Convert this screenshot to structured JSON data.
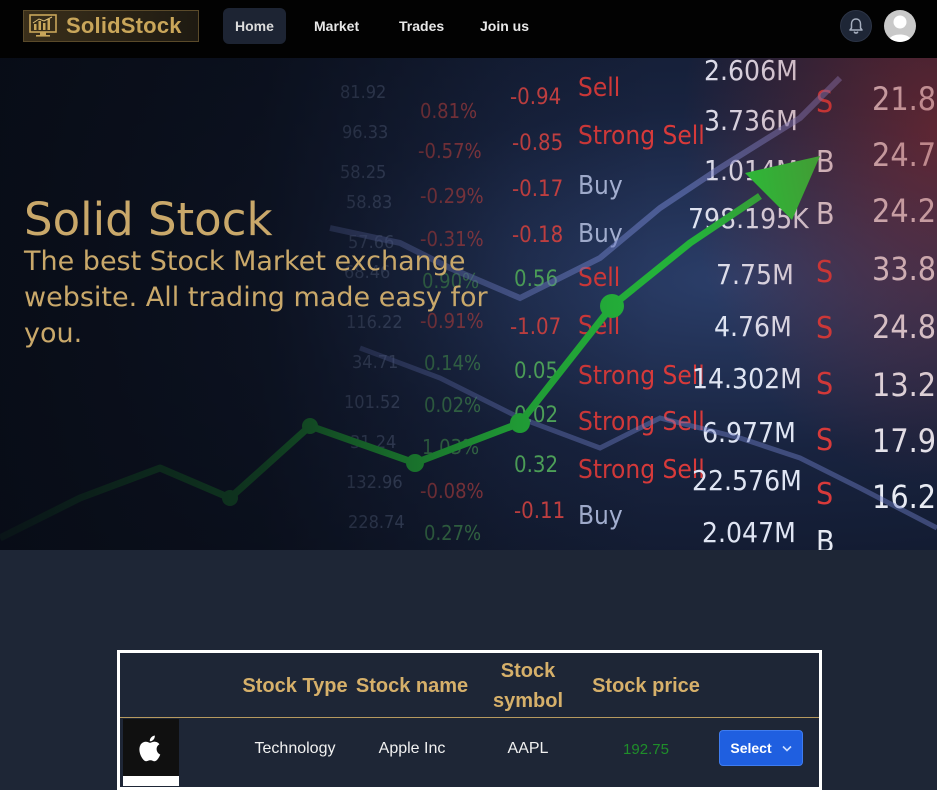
{
  "brand": {
    "name": "SolidStock"
  },
  "nav": {
    "items": [
      {
        "label": "Home",
        "active": true
      },
      {
        "label": "Market",
        "active": false
      },
      {
        "label": "Trades",
        "active": false
      },
      {
        "label": "Join us",
        "active": false
      }
    ],
    "icons": [
      "bell-icon",
      "user-avatar-icon"
    ]
  },
  "hero": {
    "title": "Solid Stock",
    "subtitle": "The best Stock Market exchange website. All trading made easy for you."
  },
  "table": {
    "headers": [
      "",
      "Stock Type",
      "Stock name",
      "Stock symbol",
      "Stock price",
      ""
    ],
    "rows": [
      {
        "logo": "apple-logo-icon",
        "type": "Technology",
        "name": "Apple Inc",
        "symbol": "AAPL",
        "price": "192.75",
        "action": "Select"
      }
    ]
  },
  "colors": {
    "accent_gold": "#c9a86a",
    "header_gold": "#d6b06a",
    "price_green": "#1f8e2a",
    "button_blue": "#1f5fe0",
    "page_bg": "#1e2636",
    "navbar_bg": "#020202"
  }
}
